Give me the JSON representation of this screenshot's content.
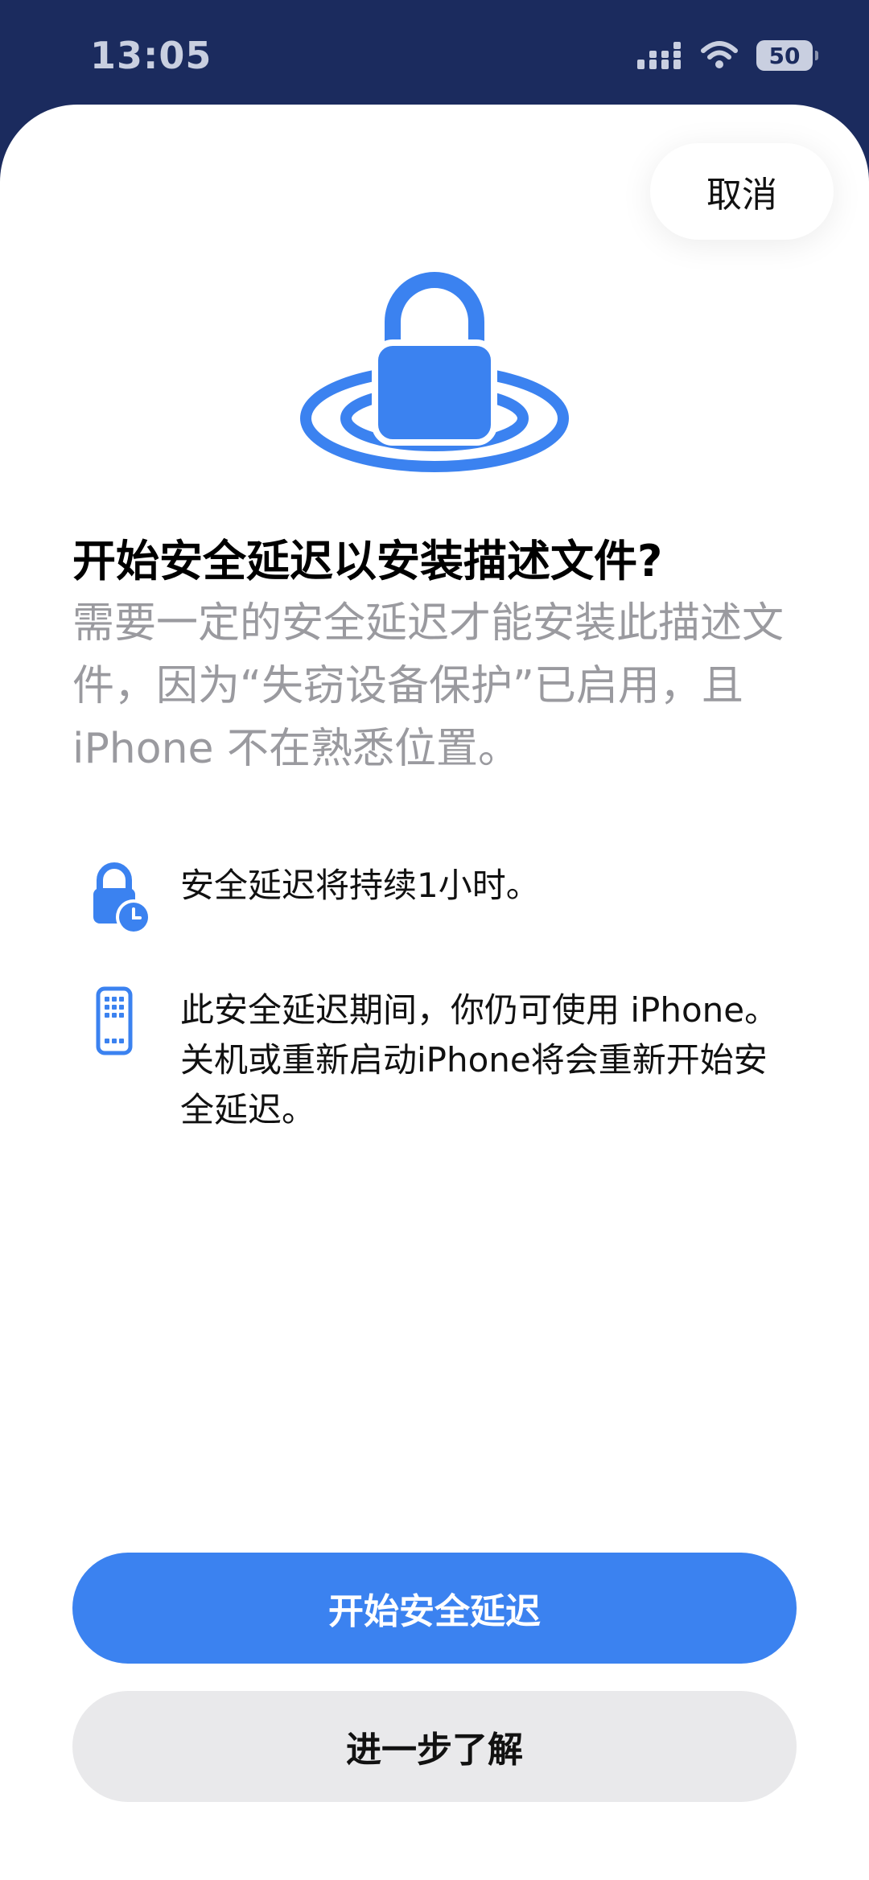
{
  "status_bar": {
    "time": "13:05",
    "battery": "50",
    "icons": [
      "cellular-signal-icon",
      "wifi-icon",
      "battery-icon"
    ]
  },
  "sheet": {
    "cancel_label": "取消",
    "title": "开始安全延迟以安装描述文件?",
    "subtitle": "需要一定的安全延迟才能安装此描述文件，因为“失窃设备保护”已启用，且 iPhone 不在熟悉位置。",
    "info": [
      {
        "icon": "lock-clock-icon",
        "text": "安全延迟将持续1小时。"
      },
      {
        "icon": "iphone-icon",
        "text": "此安全延迟期间，你仍可使用 iPhone。关机或重新启动iPhone将会重新开始安全延迟。"
      }
    ],
    "primary_label": "开始安全延迟",
    "secondary_label": "进一步了解"
  },
  "colors": {
    "accent": "#3b82f0",
    "status_bar_bg": "#1b2b5e",
    "secondary_text": "#9a9a9f",
    "secondary_button_bg": "#e9e9eb"
  }
}
